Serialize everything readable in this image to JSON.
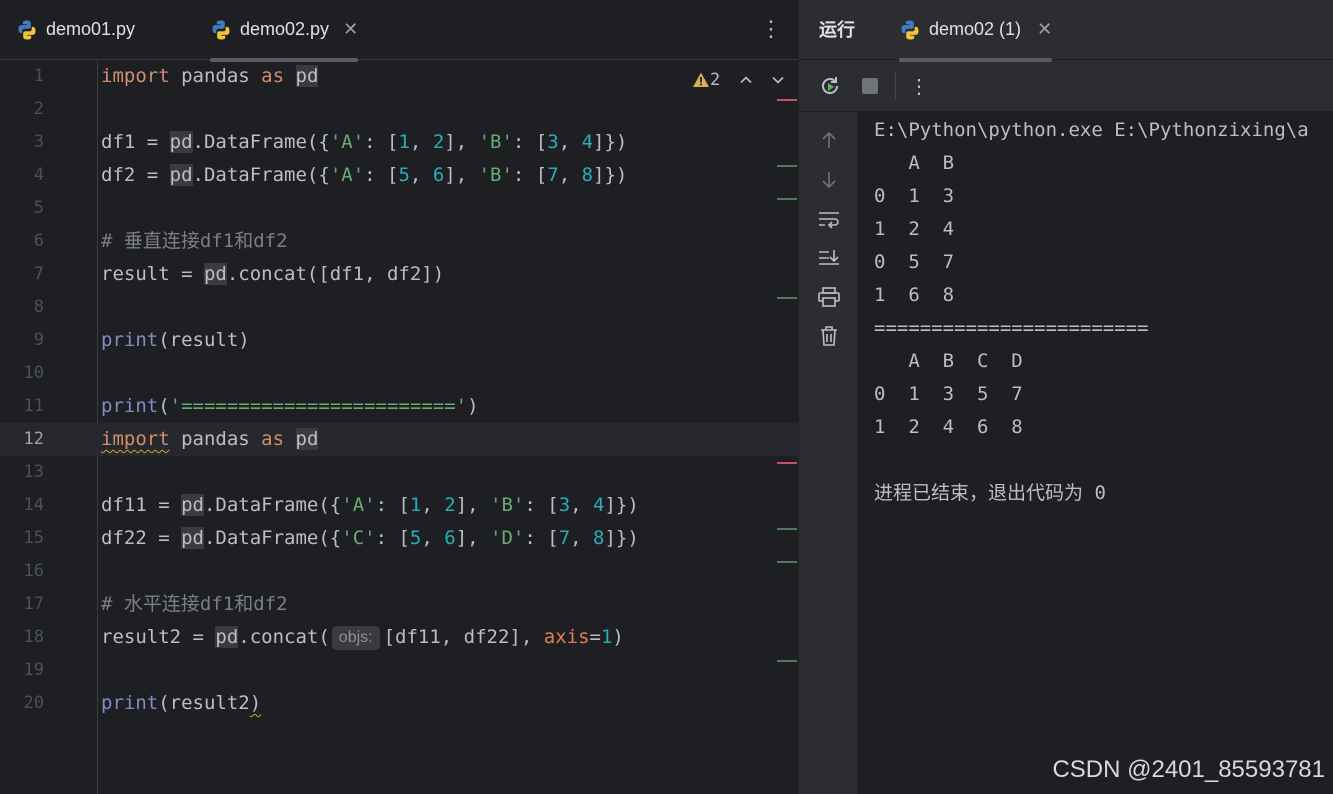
{
  "editor": {
    "tabs": [
      {
        "label": "demo01.py"
      },
      {
        "label": "demo02.py"
      }
    ],
    "warning_count": "2",
    "inlay_hint": "objs:",
    "line_numbers": [
      "1",
      "2",
      "3",
      "4",
      "5",
      "6",
      "7",
      "8",
      "9",
      "10",
      "11",
      "12",
      "13",
      "14",
      "15",
      "16",
      "17",
      "18",
      "19",
      "20"
    ],
    "code": {
      "import": "import",
      "pandas": " pandas ",
      "as": "as",
      "pd": "pd",
      "l3_pre": "df1 = ",
      "l3_a": ".DataFrame({",
      "sA": "'A'",
      "colon_open": ": [",
      "n1": "1",
      "comma": ", ",
      "n2": "2",
      "close_comma": "], ",
      "sB": "'B'",
      "n3": "3",
      "n4": "4",
      "end": "]})",
      "l4_pre": "df2 = ",
      "n5": "5",
      "n6": "6",
      "n7": "7",
      "n8": "8",
      "l6_comment": "# 垂直连接df1和df2",
      "l7_pre": "result = ",
      "l7_post": ".concat([df1, df2])",
      "print": "print",
      "l9_args": "(result)",
      "l11_open": "(",
      "l11_str": "'========================'",
      "l11_close": ")",
      "l14_pre": "df11 = ",
      "l15_pre": "df22 = ",
      "sC": "'C'",
      "sD": "'D'",
      "l17_comment": "# 水平连接df1和df2",
      "l18_pre": "result2 = ",
      "l18_mid": ".concat(",
      "l18_args": "[df11, df22], ",
      "axis": "axis",
      "l18_eq": "=",
      "l18_one": "1",
      "l18_close": ")",
      "l20_args": "(result2",
      "l20_close": ")"
    }
  },
  "run": {
    "title": "运行",
    "tab_label": "demo02 (1)",
    "console": [
      "E:\\Python\\python.exe E:\\Pythonzixing\\a",
      "   A  B",
      "0  1  3",
      "1  2  4",
      "0  5  7",
      "1  6  8",
      "========================",
      "   A  B  C  D",
      "0  1  3  5  7",
      "1  2  4  6  8",
      "",
      "进程已结束，退出代码为 0"
    ]
  },
  "watermark": "CSDN @2401_85593781",
  "colors": {
    "background": "#1e1f22",
    "panel": "#2b2d30",
    "keyword": "#cf8e6d",
    "string": "#6aab73",
    "number": "#2aacb8"
  }
}
